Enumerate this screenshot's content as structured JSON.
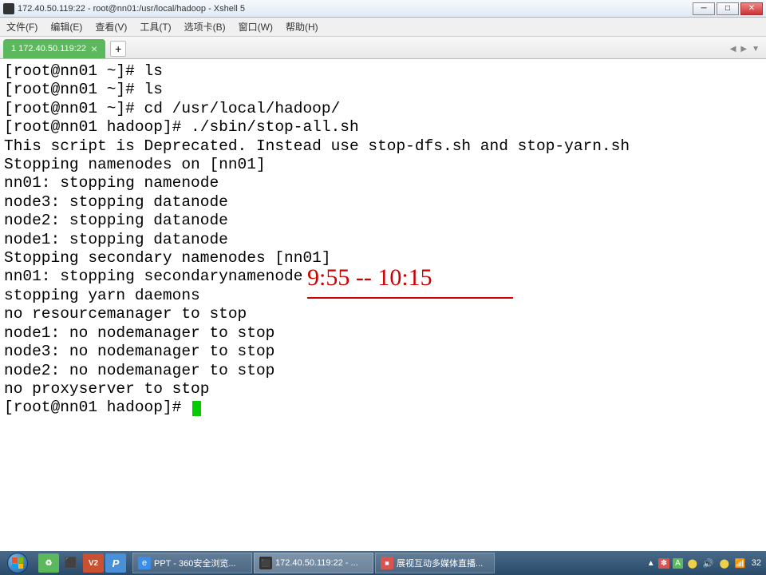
{
  "window": {
    "title": "172.40.50.119:22 - root@nn01:/usr/local/hadoop - Xshell 5"
  },
  "menu": {
    "file": "文件(F)",
    "edit": "编辑(E)",
    "view": "查看(V)",
    "tools": "工具(T)",
    "tabs": "选项卡(B)",
    "window": "窗口(W)",
    "help": "帮助(H)"
  },
  "tab": {
    "label": "1 172.40.50.119:22"
  },
  "terminal": {
    "content": "[root@nn01 ~]# ls\n[root@nn01 ~]# ls\n[root@nn01 ~]# cd /usr/local/hadoop/\n[root@nn01 hadoop]# ./sbin/stop-all.sh\nThis script is Deprecated. Instead use stop-dfs.sh and stop-yarn.sh\nStopping namenodes on [nn01]\nnn01: stopping namenode\nnode3: stopping datanode\nnode2: stopping datanode\nnode1: stopping datanode\nStopping secondary namenodes [nn01]\nnn01: stopping secondarynamenode\nstopping yarn daemons\nno resourcemanager to stop\nnode1: no nodemanager to stop\nnode3: no nodemanager to stop\nnode2: no nodemanager to stop\nno proxyserver to stop\n[root@nn01 hadoop]# "
  },
  "annotation": {
    "text": "9:55 -- 10:15"
  },
  "taskbar": {
    "items": [
      {
        "label": "PPT - 360安全浏览..."
      },
      {
        "label": "172.40.50.119:22 - ..."
      },
      {
        "label": "展视互动多媒体直播..."
      }
    ],
    "time": "32"
  }
}
